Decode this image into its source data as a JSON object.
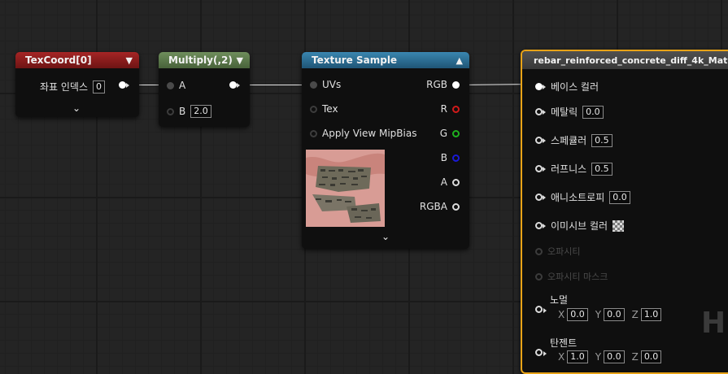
{
  "colors": {
    "texcoord_header": "#8a1e1e",
    "multiply_header": "#5a7a4a",
    "texture_header": "#2f6f93",
    "material_header": "#4a4a4a",
    "material_border": "#e8a317"
  },
  "texcoord": {
    "title": "TexCoord[0]",
    "collapse_icon": "chevron-down-icon",
    "coord_index_label": "좌표 인덱스",
    "coord_index_value": "0",
    "expand_icon": "chevron-down-icon"
  },
  "multiply": {
    "title": "Multiply(,2)",
    "input_a_label": "A",
    "input_b_label": "B",
    "input_b_value": "2.0"
  },
  "texture_sample": {
    "title": "Texture Sample",
    "collapse_icon": "chevron-up-icon",
    "inputs": [
      "UVs",
      "Tex",
      "Apply View MipBias"
    ],
    "outputs": [
      "RGB",
      "R",
      "G",
      "B",
      "A",
      "RGBA"
    ],
    "expand_icon": "chevron-down-icon"
  },
  "material": {
    "title": "rebar_reinforced_concrete_diff_4k_Mat",
    "base_color_label": "베이스 컬러",
    "metallic_label": "메탈릭",
    "metallic_value": "0.0",
    "specular_label": "스페큘러",
    "specular_value": "0.5",
    "roughness_label": "러프니스",
    "roughness_value": "0.5",
    "anisotropy_label": "애니소트로피",
    "anisotropy_value": "0.0",
    "emissive_label": "이미시브 컬러",
    "opacity_label": "오파시티",
    "opacity_mask_label": "오파시티 마스크",
    "normal_label": "노멀",
    "normal_x_label": "X",
    "normal_x": "0.0",
    "normal_y_label": "Y",
    "normal_y": "0.0",
    "normal_z_label": "Z",
    "normal_z": "1.0",
    "tangent_label": "탄젠트",
    "tangent_x_label": "X",
    "tangent_x": "1.0",
    "tangent_y_label": "Y",
    "tangent_y": "0.0",
    "tangent_z_label": "Z",
    "tangent_z": "0.0"
  },
  "watermark": "H"
}
